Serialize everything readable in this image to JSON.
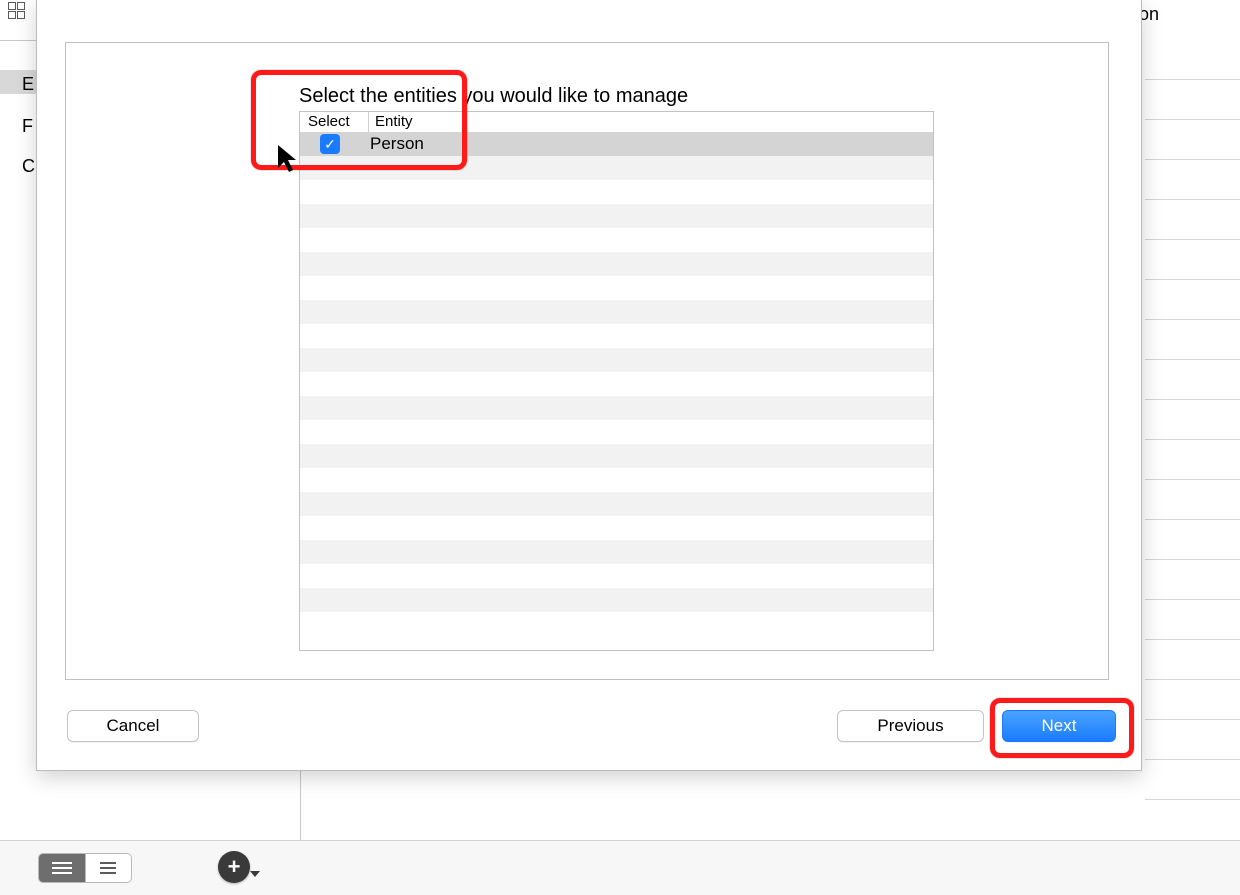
{
  "background": {
    "right_title_fragment": "son",
    "left_letters": [
      "E",
      "F",
      "C"
    ]
  },
  "dialog": {
    "prompt": "Select the entities you would like to manage",
    "columns": {
      "select": "Select",
      "entity": "Entity"
    },
    "rows": [
      {
        "selected": true,
        "entity": "Person"
      }
    ],
    "buttons": {
      "cancel": "Cancel",
      "previous": "Previous",
      "next": "Next"
    }
  },
  "bottom_bar": {
    "add_label": "+"
  }
}
